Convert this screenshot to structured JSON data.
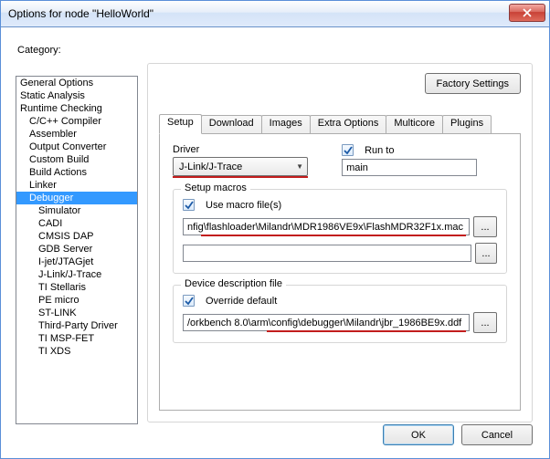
{
  "window": {
    "title": "Options for node \"HelloWorld\""
  },
  "category_label": "Category:",
  "categories": [
    {
      "label": "General Options",
      "indent": 0
    },
    {
      "label": "Static Analysis",
      "indent": 0
    },
    {
      "label": "Runtime Checking",
      "indent": 0
    },
    {
      "label": "C/C++ Compiler",
      "indent": 1
    },
    {
      "label": "Assembler",
      "indent": 1
    },
    {
      "label": "Output Converter",
      "indent": 1
    },
    {
      "label": "Custom Build",
      "indent": 1
    },
    {
      "label": "Build Actions",
      "indent": 1
    },
    {
      "label": "Linker",
      "indent": 1
    },
    {
      "label": "Debugger",
      "indent": 1,
      "selected": true
    },
    {
      "label": "Simulator",
      "indent": 2
    },
    {
      "label": "CADI",
      "indent": 2
    },
    {
      "label": "CMSIS DAP",
      "indent": 2
    },
    {
      "label": "GDB Server",
      "indent": 2
    },
    {
      "label": "I-jet/JTAGjet",
      "indent": 2
    },
    {
      "label": "J-Link/J-Trace",
      "indent": 2
    },
    {
      "label": "TI Stellaris",
      "indent": 2
    },
    {
      "label": "PE micro",
      "indent": 2
    },
    {
      "label": "ST-LINK",
      "indent": 2
    },
    {
      "label": "Third-Party Driver",
      "indent": 2
    },
    {
      "label": "TI MSP-FET",
      "indent": 2
    },
    {
      "label": "TI XDS",
      "indent": 2
    }
  ],
  "right": {
    "factory_settings": "Factory Settings",
    "tabs": [
      "Setup",
      "Download",
      "Images",
      "Extra Options",
      "Multicore",
      "Plugins"
    ],
    "active_tab": 0,
    "driver_label": "Driver",
    "driver_value": "J-Link/J-Trace",
    "runto_label": "Run to",
    "runto_checked": true,
    "runto_value": "main",
    "macros": {
      "legend": "Setup macros",
      "use_label": "Use macro file(s)",
      "use_checked": true,
      "file1": "nfig\\flashloader\\Milandr\\MDR1986VE9x\\FlashMDR32F1x.mac",
      "file2": ""
    },
    "ddf": {
      "legend": "Device description file",
      "override_label": "Override default",
      "override_checked": true,
      "file": "/orkbench 8.0\\arm\\config\\debugger\\Milandr\\jbr_1986BE9x.ddf"
    }
  },
  "footer": {
    "ok": "OK",
    "cancel": "Cancel"
  }
}
